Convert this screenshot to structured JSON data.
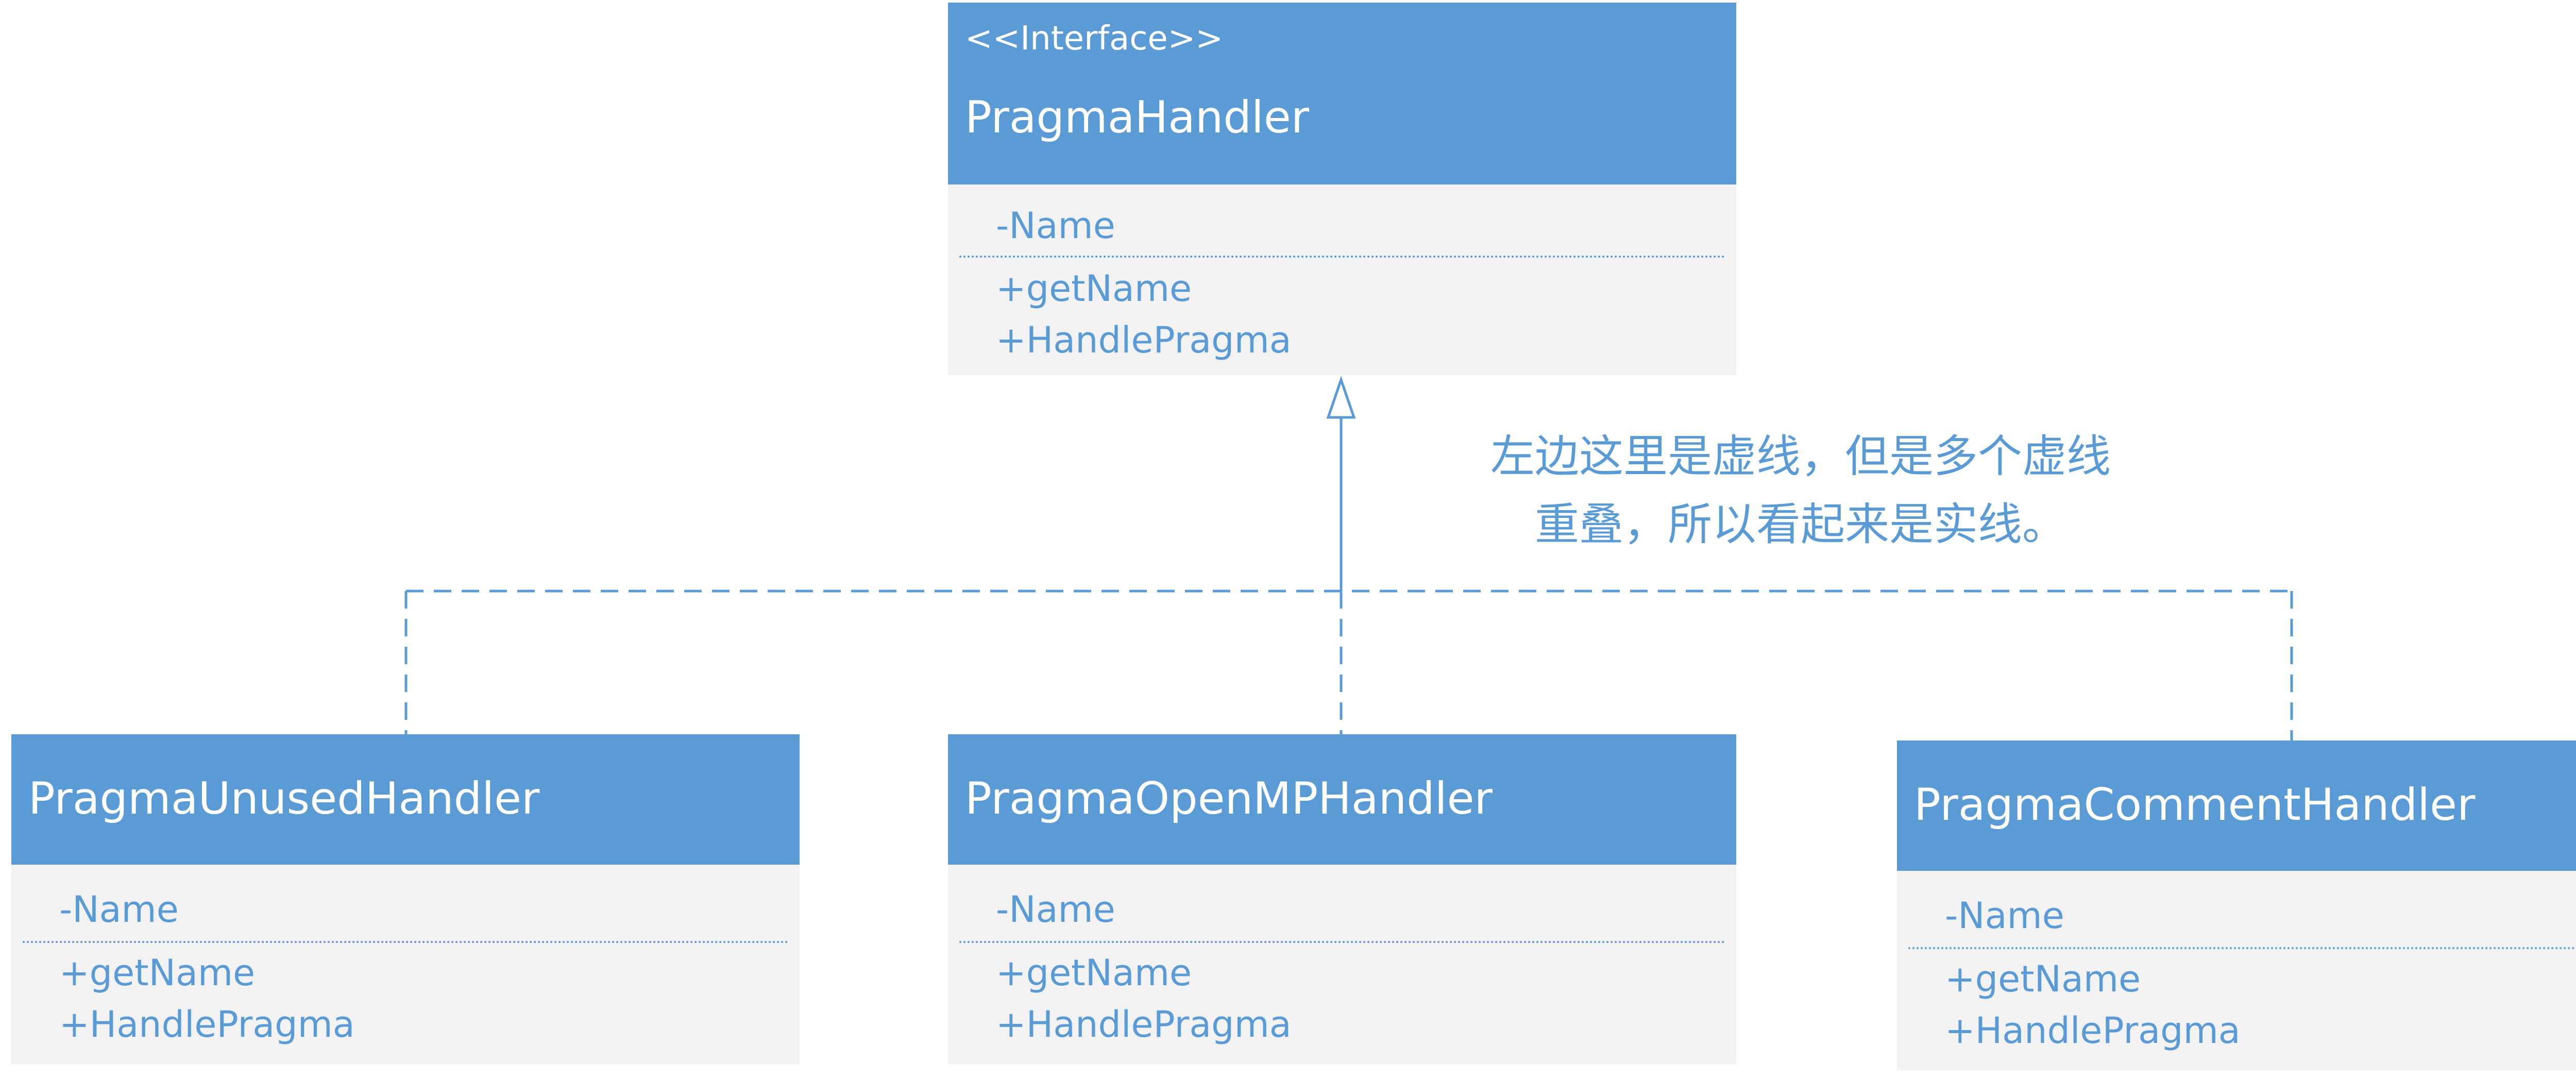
{
  "interface": {
    "stereotype": "<<Interface>>",
    "name": "PragmaHandler",
    "attributes": [
      "-Name"
    ],
    "operations": [
      "+getName",
      "+HandlePragma"
    ]
  },
  "implementations": [
    {
      "name": "PragmaUnusedHandler",
      "attributes": [
        "-Name"
      ],
      "operations": [
        "+getName",
        "+HandlePragma"
      ]
    },
    {
      "name": "PragmaOpenMPHandler",
      "attributes": [
        "-Name"
      ],
      "operations": [
        "+getName",
        "+HandlePragma"
      ]
    },
    {
      "name": "PragmaCommentHandler",
      "attributes": [
        "-Name"
      ],
      "operations": [
        "+getName",
        "+HandlePragma"
      ]
    }
  ],
  "note": {
    "line1": "左边这里是虚线，但是多个虚线",
    "line2": "重叠，所以看起来是实线。"
  },
  "colors": {
    "header": "#5b9bd5",
    "body": "#f2f2f2",
    "text": "#5b9bd5",
    "line": "#5b9bd5"
  }
}
